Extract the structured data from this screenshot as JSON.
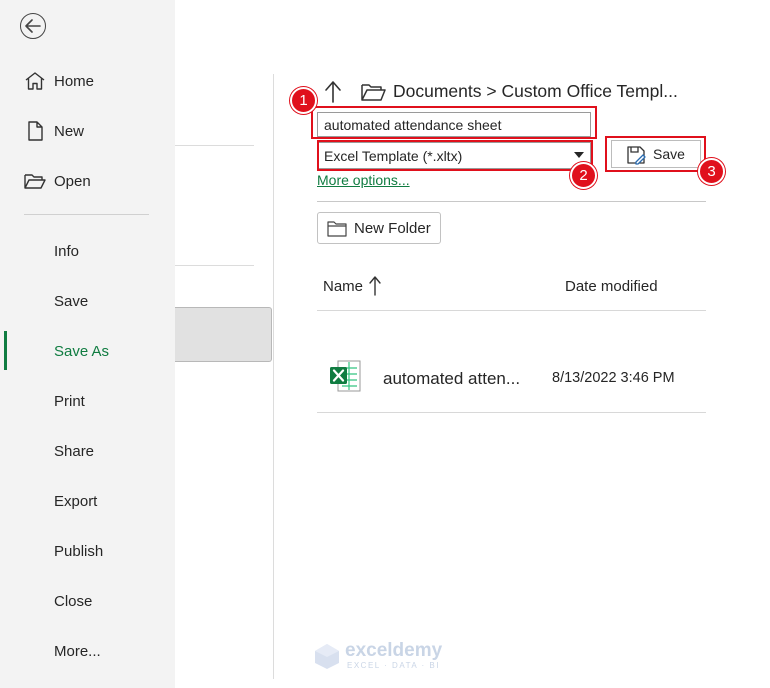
{
  "nav": {
    "items": [
      {
        "label": "Home",
        "icon": "home-icon"
      },
      {
        "label": "New",
        "icon": "new-document-icon"
      },
      {
        "label": "Open",
        "icon": "open-folder-icon"
      },
      {
        "label": "Info"
      },
      {
        "label": "Save"
      },
      {
        "label": "Save As",
        "active": true
      },
      {
        "label": "Print"
      },
      {
        "label": "Share"
      },
      {
        "label": "Export"
      },
      {
        "label": "Publish"
      },
      {
        "label": "Close"
      },
      {
        "label": "More..."
      }
    ]
  },
  "save_as": {
    "path": "Documents > Custom Office Templ...",
    "filename_value": "automated attendance sheet",
    "filetype_value": "Excel Template (*.xltx)",
    "more_options_label": "More options...",
    "save_label": "Save",
    "new_folder_label": "New Folder",
    "columns": {
      "name": "Name",
      "date": "Date modified"
    },
    "files": [
      {
        "name": "automated atten...",
        "date": "8/13/2022 3:46 PM",
        "icon": "excel-file-icon"
      }
    ]
  },
  "annotations": {
    "step1": "1",
    "step2": "2",
    "step3": "3",
    "color": "#e0101c"
  },
  "watermark": {
    "name": "exceldemy",
    "tagline": "EXCEL · DATA · BI"
  },
  "colors": {
    "accent": "#107c41",
    "nav_bg": "#f3f3f3"
  }
}
